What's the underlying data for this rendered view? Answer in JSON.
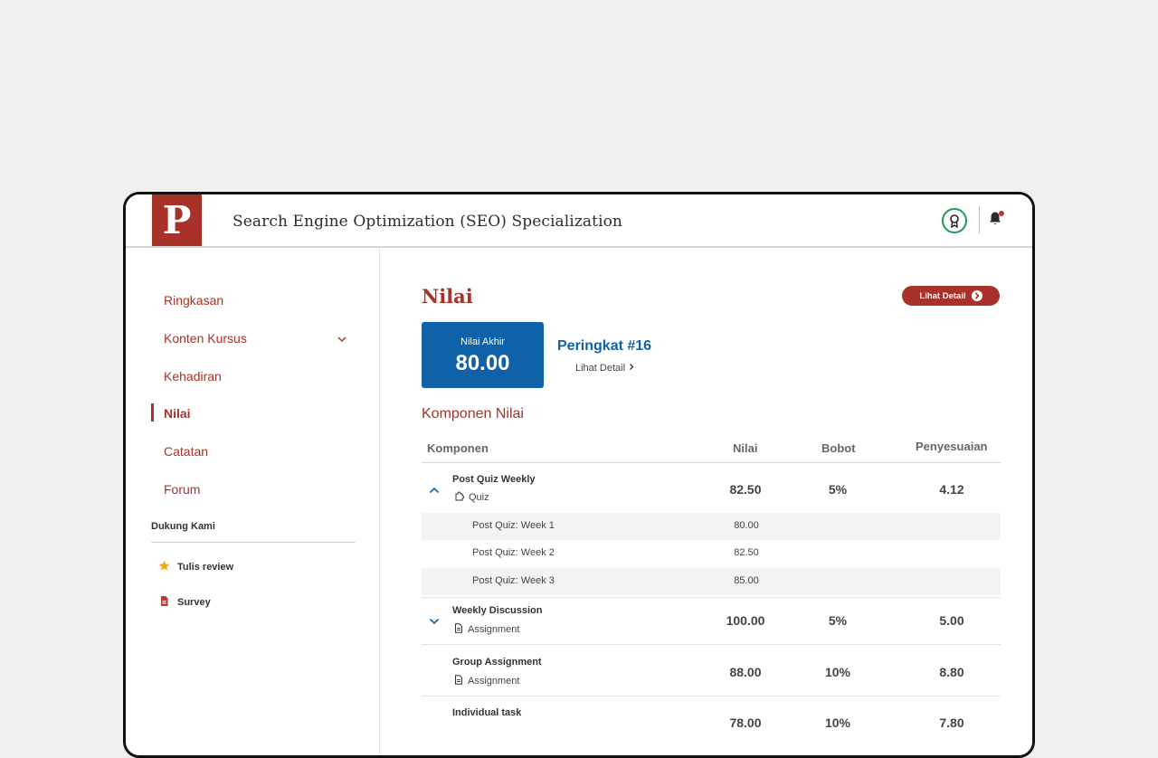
{
  "header": {
    "logo_letter": "P",
    "title": "Search Engine Optimization (SEO) Specialization",
    "badge_icon": "award-icon",
    "bell_icon": "bell-icon"
  },
  "sidebar": {
    "items": [
      {
        "label": "Ringkasan"
      },
      {
        "label": "Konten Kursus"
      },
      {
        "label": "Kehadiran"
      },
      {
        "label": "Nilai"
      },
      {
        "label": "Catatan"
      },
      {
        "label": "Forum"
      }
    ],
    "support_title": "Dukung Kami",
    "support_items": [
      {
        "label": "Tulis review",
        "icon": "star-icon"
      },
      {
        "label": "Survey",
        "icon": "document-icon"
      }
    ]
  },
  "main": {
    "title": "Nilai",
    "detail_button": "Lihat Detail",
    "final_score_label": "Nilai Akhir",
    "final_score_value": "80.00",
    "rank": "Peringkat #16",
    "rank_link": "Lihat Detail",
    "components_title": "Komponen Nilai",
    "columns": [
      "Komponen",
      "Nilai",
      "Bobot",
      "Penyesuaian"
    ],
    "rows": [
      {
        "name": "Post Quiz Weekly",
        "type": "Quiz",
        "nilai": "82.50",
        "bobot": "5%",
        "penyesuaian": "4.12"
      },
      {
        "name": "Weekly Discussion",
        "type": "Assignment",
        "nilai": "100.00",
        "bobot": "5%",
        "penyesuaian": "5.00"
      },
      {
        "name": "Group Assignment",
        "type": "Assignment",
        "nilai": "88.00",
        "bobot": "10%",
        "penyesuaian": "8.80"
      },
      {
        "name": "Individual task",
        "type": "",
        "nilai": "78.00",
        "bobot": "10%",
        "penyesuaian": "7.80"
      }
    ],
    "sub_rows": [
      {
        "name": "Post Quiz: Week 1",
        "nilai": "80.00"
      },
      {
        "name": "Post Quiz: Week 2",
        "nilai": "82.50"
      },
      {
        "name": "Post Quiz: Week 3",
        "nilai": "85.00"
      }
    ]
  },
  "colors": {
    "brand": "#a8322a",
    "accent_blue": "#0f62a8",
    "badge_green": "#1e9a5a"
  }
}
